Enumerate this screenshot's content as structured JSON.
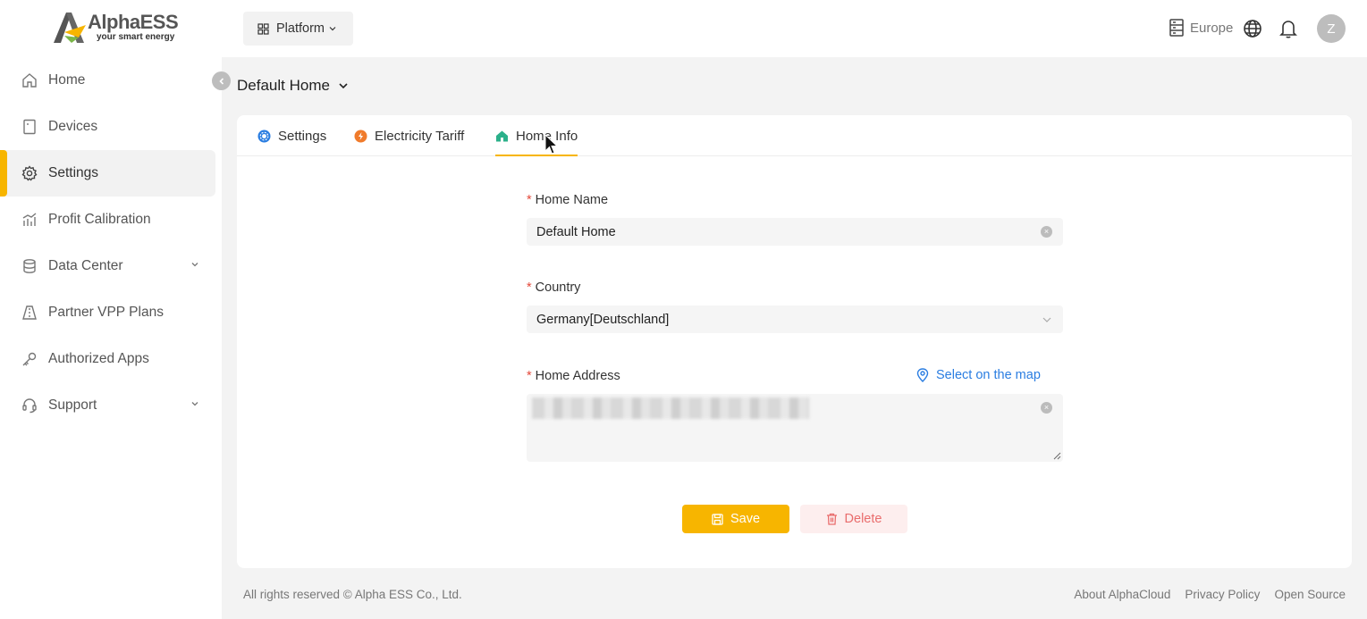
{
  "brand": {
    "name": "AlphaESS",
    "tagline": "your smart energy"
  },
  "sidebar": {
    "items": [
      {
        "label": "Home",
        "icon": "home-icon"
      },
      {
        "label": "Devices",
        "icon": "device-icon"
      },
      {
        "label": "Settings",
        "icon": "gear-icon",
        "active": true
      },
      {
        "label": "Profit Calibration",
        "icon": "chart-icon"
      },
      {
        "label": "Data Center",
        "icon": "database-icon",
        "expandable": true
      },
      {
        "label": "Partner VPP Plans",
        "icon": "road-icon"
      },
      {
        "label": "Authorized Apps",
        "icon": "key-icon"
      },
      {
        "label": "Support",
        "icon": "headset-icon",
        "expandable": true
      }
    ]
  },
  "header": {
    "platform_label": "Platform",
    "region": "Europe",
    "avatar_initial": "Z"
  },
  "home_selector": {
    "label": "Default Home"
  },
  "tabs": [
    {
      "label": "Settings",
      "icon": "gear-icon",
      "color": "#2a7de1"
    },
    {
      "label": "Electricity Tariff",
      "icon": "tariff-icon",
      "color": "#f07b2b"
    },
    {
      "label": "Home Info",
      "icon": "home-icon",
      "color": "#2bb08a",
      "active": true
    }
  ],
  "form": {
    "home_name": {
      "label": "Home Name",
      "value": "Default Home"
    },
    "country": {
      "label": "Country",
      "value": "Germany[Deutschland]"
    },
    "home_address": {
      "label": "Home Address",
      "map_link": "Select on the map"
    },
    "save_label": "Save",
    "delete_label": "Delete"
  },
  "footer": {
    "copyright": "All rights reserved © Alpha ESS Co., Ltd.",
    "links": [
      "About AlphaCloud",
      "Privacy Policy",
      "Open Source"
    ]
  },
  "colors": {
    "accent": "#f7b500",
    "link": "#2a7de1",
    "danger": "#e96d6d"
  }
}
